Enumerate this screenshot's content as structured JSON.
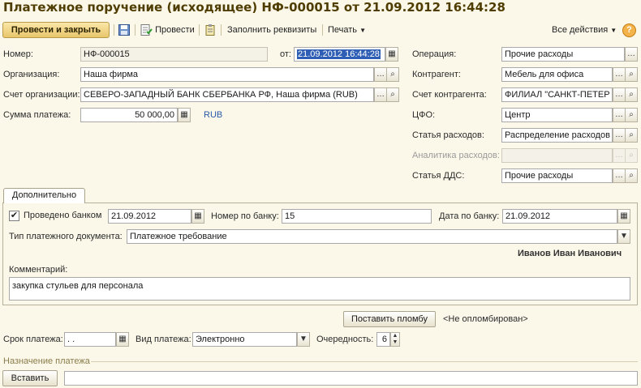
{
  "window": {
    "title": "Платежное поручение (исходящее) НФ-000015 от 21.09.2012 16:44:28"
  },
  "toolbar": {
    "post_and_close": "Провести и закрыть",
    "post": "Провести",
    "fill_details": "Заполнить реквизиты",
    "print": "Печать",
    "all_actions": "Все действия",
    "help": "?"
  },
  "form": {
    "number_label": "Номер:",
    "number_value": "НФ-000015",
    "date_label": "от:",
    "date_value": "21.09.2012 16:44:28",
    "operation_label": "Операция:",
    "operation_value": "Прочие расходы",
    "org_label": "Организация:",
    "org_value": "Наша фирма",
    "counterparty_label": "Контрагент:",
    "counterparty_value": "Мебель для офиса",
    "org_account_label": "Счет организации:",
    "org_account_value": "СЕВЕРО-ЗАПАДНЫЙ БАНК СБЕРБАНКА РФ, Наша фирма (RUB)",
    "cp_account_label": "Счет контрагента:",
    "cp_account_value": "ФИЛИАЛ \"САНКТ-ПЕТЕР",
    "amount_label": "Сумма платежа:",
    "amount_value": "50 000,00",
    "currency": "RUB",
    "cfo_label": "ЦФО:",
    "cfo_value": "Центр",
    "expense_item_label": "Статья расходов:",
    "expense_item_value": "Распределение расходов",
    "expense_analytics_label": "Аналитика расходов:",
    "expense_analytics_value": "",
    "dds_label": "Статья ДДС:",
    "dds_value": "Прочие расходы"
  },
  "tabs": {
    "additional": "Дополнительно"
  },
  "additional": {
    "bank_posted_label": "Проведено банком",
    "bank_posted_checked": "✔",
    "bank_posted_date": "21.09.2012",
    "bank_number_label": "Номер по банку:",
    "bank_number_value": "15",
    "bank_date_label": "Дата по банку:",
    "bank_date_value": "21.09.2012",
    "doc_type_label": "Тип платежного документа:",
    "doc_type_value": "Платежное требование",
    "responsible": "Иванов Иван Иванович",
    "comment_label": "Комментарий:",
    "comment_value": "закупка стульев для персонала"
  },
  "seal": {
    "button": "Поставить пломбу",
    "status": "<Не опломбирован>"
  },
  "payment": {
    "due_label": "Срок платежа:",
    "due_value": " .  .",
    "type_label": "Вид платежа:",
    "type_value": "Электронно",
    "priority_label": "Очередность:",
    "priority_value": "6"
  },
  "purpose": {
    "section_label": "Назначение платежа",
    "insert_button": "Вставить",
    "value": ""
  }
}
